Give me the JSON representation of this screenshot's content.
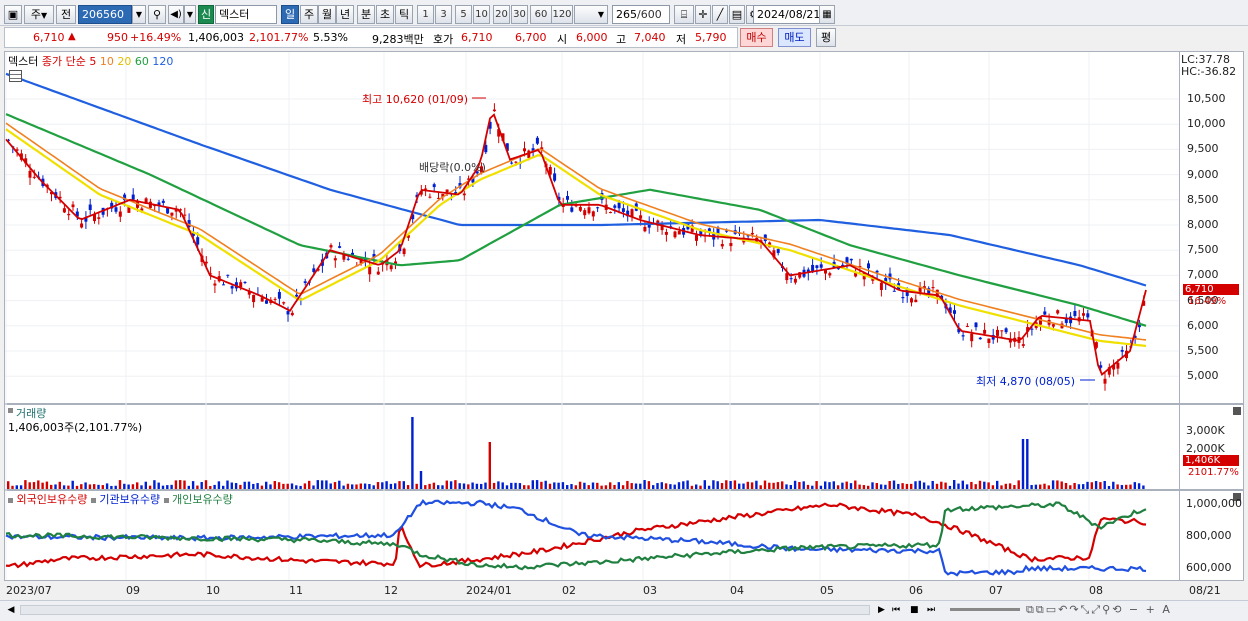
{
  "toolbar": {
    "type_label": "주",
    "prev_label": "전",
    "code": "206560",
    "shin_badge": "신",
    "stock_name": "덱스터",
    "periods": [
      "일",
      "주",
      "월",
      "년",
      "분",
      "초",
      "틱"
    ],
    "minutes": [
      "1",
      "3",
      "5",
      "10",
      "20",
      "30",
      "60",
      "120"
    ],
    "count": "265",
    "count_total": "/600",
    "date": "2024/08/21"
  },
  "quote": {
    "price": "6,710",
    "arrow": "▲",
    "change": "950",
    "change_pct": "+16.49%",
    "volume": "1,406,003",
    "volume_pct": "2,101.77%",
    "turnover_rate": "5.53%",
    "amount": "9,283백만",
    "ask_label": "호가",
    "ask": "6,710",
    "bid": "6,700",
    "open_label": "시",
    "open": "6,000",
    "high_label": "고",
    "high": "7,040",
    "low_label": "저",
    "low": "5,790",
    "buy_label": "매수",
    "sell_label": "매도",
    "eval_label": "평"
  },
  "price_panel": {
    "legend_name": "덱스터",
    "legend_type": "종가 단순",
    "ma_labels": [
      "5",
      "10",
      "20",
      "60",
      "120"
    ],
    "ma_colors": [
      "#d40000",
      "#f08020",
      "#e0c000",
      "#20a040",
      "#2060e0"
    ],
    "lc": "LC:37.78",
    "hc": "HC:-36.82",
    "current_price_badge": "6,710",
    "current_pct_badge": "16.49%",
    "high_annot": "최고 10,620 (01/09)",
    "low_annot": "최저 4,870 (08/05)",
    "dividend_annot": "배당락(0.0%)",
    "yticks": [
      "10,500",
      "10,000",
      "9,500",
      "9,000",
      "8,500",
      "8,000",
      "7,500",
      "7,000",
      "6,500",
      "6,000",
      "5,500",
      "5,000"
    ]
  },
  "volume_panel": {
    "title": "거래량",
    "value": "1,406,003주(2,101.77%)",
    "yticks": [
      "3,000K",
      "2,000K"
    ],
    "badge": "1,406K",
    "badge_pct": "2101.77%"
  },
  "holdings_panel": {
    "series": [
      "외국인보유수량",
      "기관보유수량",
      "개인보유수량"
    ],
    "colors": [
      "#d40000",
      "#2050e0",
      "#208040"
    ],
    "yticks": [
      "1,000,000",
      "800,000",
      "600,000"
    ]
  },
  "xaxis": {
    "labels": [
      "2023/07",
      "09",
      "10",
      "11",
      "12",
      "2024/01",
      "02",
      "03",
      "04",
      "05",
      "06",
      "07",
      "08",
      "08/21"
    ]
  },
  "colors": {
    "up": "#d40000",
    "down": "#0020d0",
    "accent": "#2d6ab4"
  }
}
